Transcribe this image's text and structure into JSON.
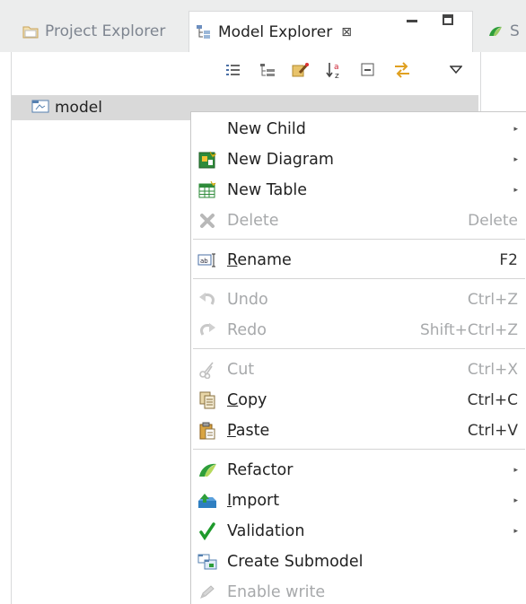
{
  "tabs": {
    "project_explorer": "Project Explorer",
    "model_explorer": "Model Explorer",
    "close_symbol": "⊠",
    "other_tab": "S"
  },
  "tree": {
    "root_label": "model"
  },
  "menu": {
    "items": [
      {
        "label": "New Child",
        "accel": "",
        "submenu": true,
        "enabled": true,
        "icon": "none"
      },
      {
        "label": "New Diagram",
        "accel": "",
        "submenu": true,
        "enabled": true,
        "icon": "new-diagram-icon"
      },
      {
        "label": "New Table",
        "accel": "",
        "submenu": true,
        "enabled": true,
        "icon": "new-table-icon"
      },
      {
        "label": "Delete",
        "accel": "Delete",
        "submenu": false,
        "enabled": false,
        "icon": "delete-icon"
      },
      {
        "label": "Rename",
        "accel": "F2",
        "submenu": false,
        "enabled": true,
        "icon": "rename-icon",
        "mnemonic": "R"
      },
      {
        "label": "Undo",
        "accel": "Ctrl+Z",
        "submenu": false,
        "enabled": false,
        "icon": "undo-icon"
      },
      {
        "label": "Redo",
        "accel": "Shift+Ctrl+Z",
        "submenu": false,
        "enabled": false,
        "icon": "redo-icon"
      },
      {
        "label": "Cut",
        "accel": "Ctrl+X",
        "submenu": false,
        "enabled": false,
        "icon": "cut-icon"
      },
      {
        "label": "Copy",
        "accel": "Ctrl+C",
        "submenu": false,
        "enabled": true,
        "icon": "copy-icon",
        "mnemonic": "C"
      },
      {
        "label": "Paste",
        "accel": "Ctrl+V",
        "submenu": false,
        "enabled": true,
        "icon": "paste-icon",
        "mnemonic": "P"
      },
      {
        "label": "Refactor",
        "accel": "",
        "submenu": true,
        "enabled": true,
        "icon": "refactor-icon"
      },
      {
        "label": "Import",
        "accel": "",
        "submenu": true,
        "enabled": true,
        "icon": "import-icon",
        "mnemonic": "I"
      },
      {
        "label": "Validation",
        "accel": "",
        "submenu": true,
        "enabled": true,
        "icon": "validation-icon"
      },
      {
        "label": "Create Submodel",
        "accel": "",
        "submenu": false,
        "enabled": true,
        "icon": "create-submodel-icon"
      },
      {
        "label": "Enable write",
        "accel": "",
        "submenu": false,
        "enabled": false,
        "icon": "enable-write-icon"
      }
    ],
    "submenu_arrow": "▸"
  },
  "colors": {
    "accent_green": "#2e9e3a",
    "accent_orange": "#e8a020",
    "disabled_text": "#a7a9ab",
    "selection_bg": "#d9d9d9"
  }
}
